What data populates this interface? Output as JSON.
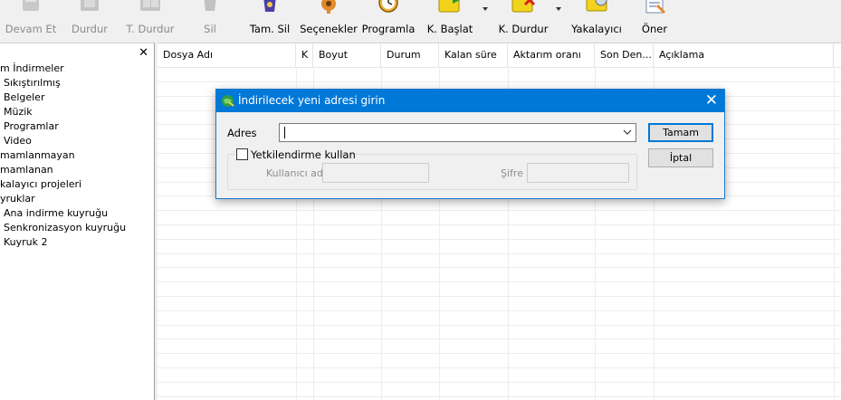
{
  "toolbar": {
    "items": [
      {
        "label": "Devam Et",
        "icon": "resume-icon",
        "enabled": false
      },
      {
        "label": "Durdur",
        "icon": "stop-icon",
        "enabled": false
      },
      {
        "label": "T. Durdur",
        "icon": "stop-all-icon",
        "enabled": false
      },
      {
        "label": "Sil",
        "icon": "delete-icon",
        "enabled": false
      },
      {
        "label": "Tam. Sil",
        "icon": "delete-completed-icon",
        "enabled": true
      },
      {
        "label": "Seçenekler",
        "icon": "gear-icon",
        "enabled": true
      },
      {
        "label": "Programla",
        "icon": "clock-icon",
        "enabled": true
      },
      {
        "label": "K. Başlat",
        "icon": "start-queue-icon",
        "enabled": true
      },
      {
        "label": "K. Durdur",
        "icon": "stop-queue-icon",
        "enabled": true
      },
      {
        "label": "Yakalayıcı",
        "icon": "grabber-icon",
        "enabled": true
      },
      {
        "label": "Öner",
        "icon": "suggest-icon",
        "enabled": true
      }
    ]
  },
  "left_panel": {
    "close_glyph": "✕",
    "tree": [
      {
        "label": "m İndirmeler",
        "level": 0
      },
      {
        "label": "Sıkıştırılmış",
        "level": 1
      },
      {
        "label": "Belgeler",
        "level": 1
      },
      {
        "label": "Müzik",
        "level": 1
      },
      {
        "label": "Programlar",
        "level": 1
      },
      {
        "label": "Video",
        "level": 1
      },
      {
        "label": "mamlanmayan",
        "level": 0
      },
      {
        "label": "mamlanan",
        "level": 0
      },
      {
        "label": "kalayıcı projeleri",
        "level": 0
      },
      {
        "label": "yruklar",
        "level": 0
      },
      {
        "label": "Ana indirme kuyruğu",
        "level": 1
      },
      {
        "label": "Senkronizasyon kuyruğu",
        "level": 1
      },
      {
        "label": "Kuyruk 2",
        "level": 1
      }
    ]
  },
  "list": {
    "columns": [
      "Dosya Adı",
      "K",
      "Boyut",
      "Durum",
      "Kalan süre",
      "Aktarım oranı",
      "Son Den...",
      "Açıklama"
    ]
  },
  "dialog": {
    "title": "İndirilecek yeni adresi girin",
    "adres_label": "Adres",
    "adres_value": "",
    "ok_label": "Tamam",
    "cancel_label": "İptal",
    "auth_checkbox_label": "Yetkilendirme kullan",
    "auth_checked": false,
    "username_label": "Kullanıcı adı",
    "password_label": "Şifre",
    "username_value": "",
    "password_value": ""
  },
  "colors": {
    "title_bar": "#0078d7",
    "dialog_bg": "#f0f0f0",
    "disabled_text": "#8a8a8a"
  }
}
